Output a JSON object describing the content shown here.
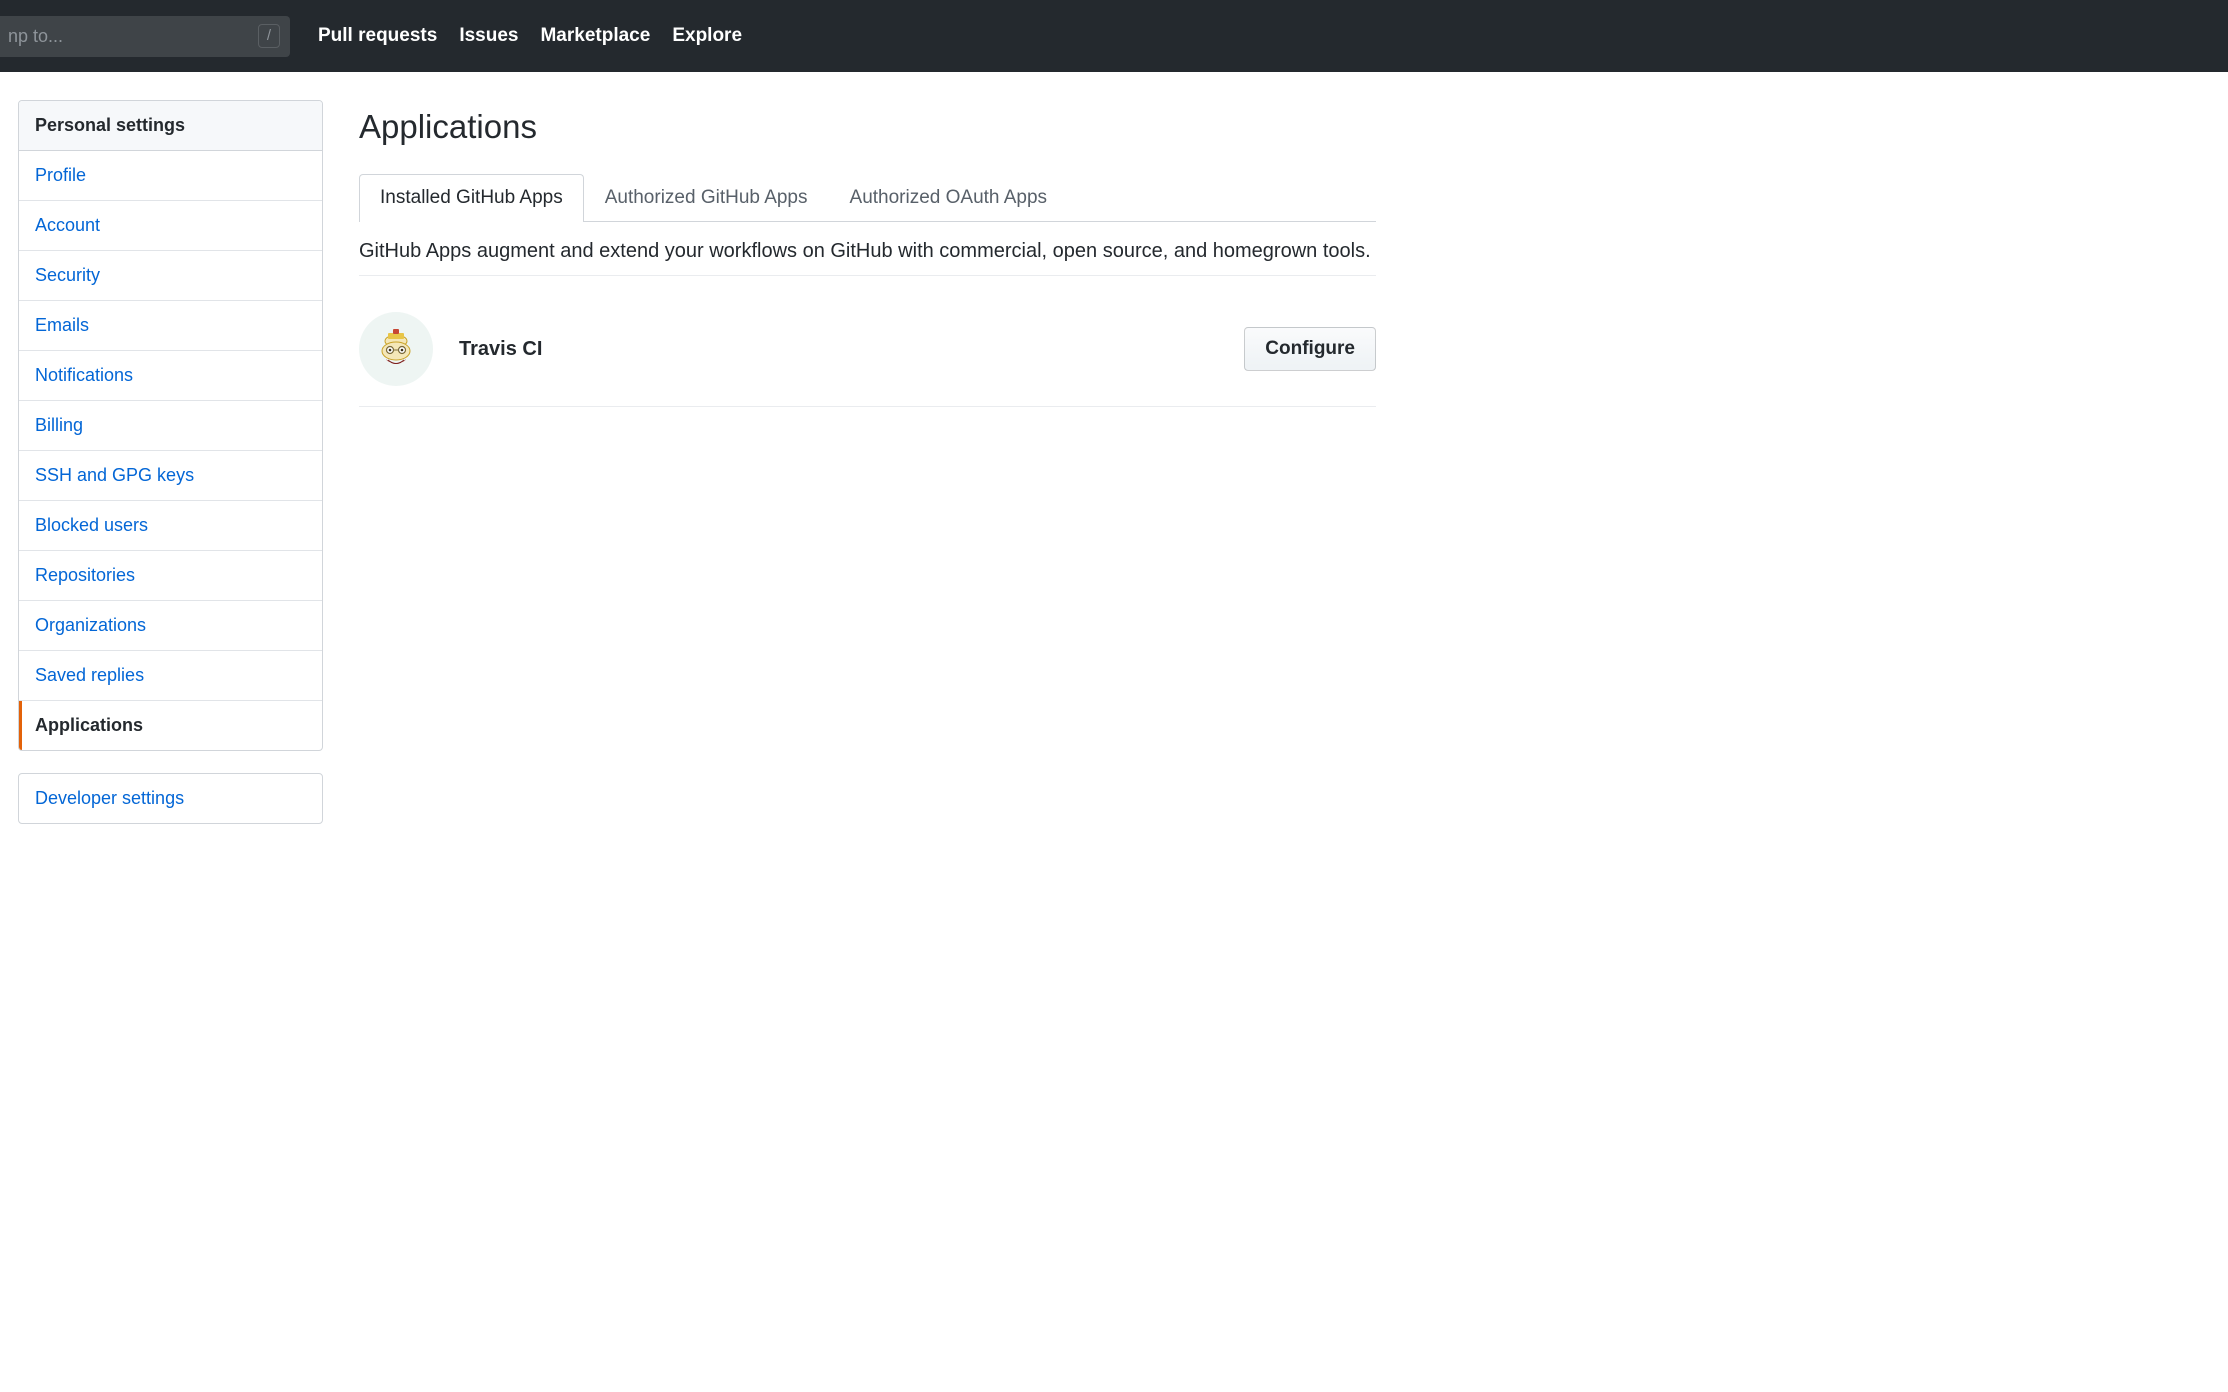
{
  "header": {
    "search_placeholder": "np to...",
    "slash_key": "/",
    "nav": {
      "pull_requests": "Pull requests",
      "issues": "Issues",
      "marketplace": "Marketplace",
      "explore": "Explore"
    }
  },
  "sidebar": {
    "header": "Personal settings",
    "items": [
      {
        "label": "Profile",
        "active": false
      },
      {
        "label": "Account",
        "active": false
      },
      {
        "label": "Security",
        "active": false
      },
      {
        "label": "Emails",
        "active": false
      },
      {
        "label": "Notifications",
        "active": false
      },
      {
        "label": "Billing",
        "active": false
      },
      {
        "label": "SSH and GPG keys",
        "active": false
      },
      {
        "label": "Blocked users",
        "active": false
      },
      {
        "label": "Repositories",
        "active": false
      },
      {
        "label": "Organizations",
        "active": false
      },
      {
        "label": "Saved replies",
        "active": false
      },
      {
        "label": "Applications",
        "active": true
      }
    ],
    "secondary": {
      "developer_settings": "Developer settings"
    }
  },
  "main": {
    "title": "Applications",
    "tabs": [
      {
        "label": "Installed GitHub Apps",
        "active": true
      },
      {
        "label": "Authorized GitHub Apps",
        "active": false
      },
      {
        "label": "Authorized OAuth Apps",
        "active": false
      }
    ],
    "description": "GitHub Apps augment and extend your workflows on GitHub with commercial, open source, and homegrown tools.",
    "apps": [
      {
        "name": "Travis CI",
        "configure_label": "Configure"
      }
    ]
  }
}
